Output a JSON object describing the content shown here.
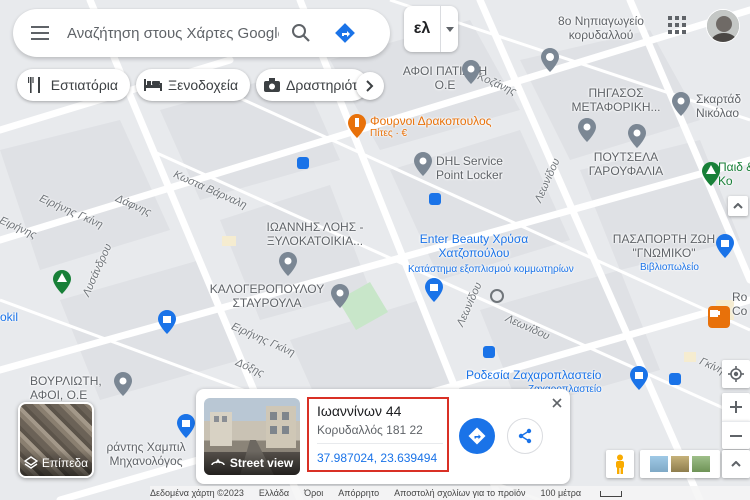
{
  "search": {
    "placeholder": "Αναζήτηση στους Χάρτες Google"
  },
  "input_tools": {
    "label": "ελ"
  },
  "chips": [
    {
      "label": "Εστιατόρια",
      "icon": "fork-knife-icon"
    },
    {
      "label": "Ξενοδοχεία",
      "icon": "bed-icon"
    },
    {
      "label": "Δραστηριότητες",
      "icon": "camera-icon"
    }
  ],
  "map": {
    "streets": [
      "Κωστα Βάρναλη",
      "Δάφνης",
      "Ειρήνης Γκίνη",
      "Λυσάνδρου",
      "Ειρήνης Γκίνη",
      "Δόξης",
      "Κοζάνης",
      "Λεωνίδου",
      "Λεωνίδου",
      "Λεωνίδου",
      "Γκίνη",
      "Ειρήνης"
    ],
    "pois": [
      {
        "name": "8ο Νηπιαγωγείο κορυδαλλού",
        "color": "#5f6368"
      },
      {
        "name": "ΑΦΟΙ ΠΑΤΙΑΔΗ Ο.Ε",
        "color": "#5f6368"
      },
      {
        "name": "ΠΗΓΑΣΟΣ ΜΕΤΑΦΟΡΙΚΗ...",
        "color": "#5f6368"
      },
      {
        "name": "Σκαρτάδ Νικόλαο",
        "color": "#5f6368"
      },
      {
        "name": "Φουρνοι Δρακοπουλος",
        "sub": "Πίτες · €",
        "color": "#e8710a"
      },
      {
        "name": "DHL Service Point Locker",
        "color": "#5f6368"
      },
      {
        "name": "ΠΟΥΤΣΕΛΑ ΓΑΡΟΥΦΑΛΙΑ",
        "color": "#5f6368"
      },
      {
        "name": "Παιδ & Κο",
        "color": "#188038"
      },
      {
        "name": "ΙΩΑΝΝΗΣ ΛΟΗΣ - ΞΥΛΟΚΑΤΟΙΚΙΑ...",
        "color": "#5f6368"
      },
      {
        "name": "Enter Beauty Χρύσα Χατζοπούλου",
        "sub": "Κατάστημα εξοπλισμού κομμωτηρίων",
        "color": "#1a73e8"
      },
      {
        "name": "ΠΑΣΑΠΟΡΤΗ ΖΩΗ \"ΓΝΩΜΙΚΟ\"",
        "sub": "Βιβλιοπωλείο",
        "color": "#1a73e8"
      },
      {
        "name": "ΚΑΛΟΓΕΡΟΠΟΥΛΟΥ ΣΤΑΥΡΟΥΛΑ",
        "color": "#5f6368"
      },
      {
        "name": "okil",
        "color": "#1a73e8"
      },
      {
        "name": "Ro Co",
        "color": "#5f6368"
      },
      {
        "name": "ΒΟΥΡΛΙΩΤΗ, ΑΦΟΙ, Ο.Ε",
        "color": "#5f6368"
      },
      {
        "name": "Ροδεσία Ζαχαροπλαστείο",
        "sub": "Ζαχαροπλαστείο",
        "color": "#1a73e8"
      },
      {
        "name": "ράντης Χαμπιλ Μηχανολόγος",
        "color": "#5f6368"
      }
    ]
  },
  "layers": {
    "label": "Επίπεδα"
  },
  "info_card": {
    "streetview_label": "Street view",
    "address_title": "Ιωαννίνων 44",
    "address_sub": "Κορυδαλλός 181 22",
    "coordinates": "37.987024, 23.639494"
  },
  "footer": {
    "items": [
      "Δεδομένα χάρτη ©2023",
      "Ελλάδα",
      "Όροι",
      "Απόρρητο",
      "Αποστολή σχολίων για το προϊόν"
    ],
    "scale": "100 μέτρα"
  },
  "colors": {
    "accent": "#1a73e8",
    "highlight_border": "#d93025",
    "food": "#e8710a",
    "park": "#188038"
  }
}
